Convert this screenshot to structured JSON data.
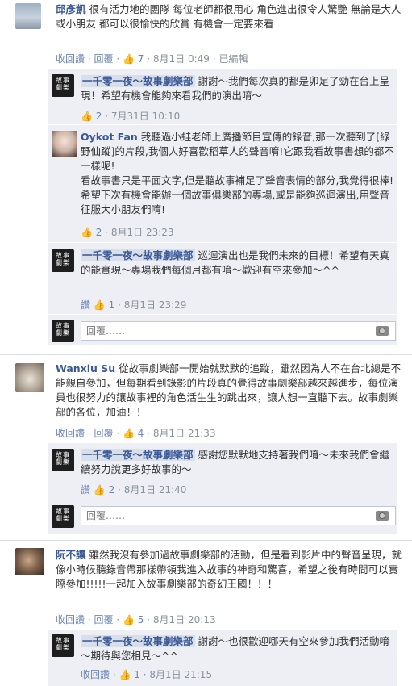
{
  "ui": {
    "reply_placeholder": "回覆……",
    "camera_icon": "camera-icon",
    "thumb_icon": "thumbs-up-icon"
  },
  "comments": [
    {
      "name": "邱彥凱",
      "text": "很有活力地的團隊 每位老師都很用心 角色進出很令人驚艷 無論是大人或小朋友 都可以很愉快的欣賞 有機會一定要來看",
      "meta": {
        "unlike": "收回讚",
        "reply": "回覆",
        "likes": "7",
        "time": "8月1日 0:49",
        "edited": "已編輯"
      },
      "replies": [
        {
          "name": "一千零一夜～故事劇樂部",
          "text": "謝謝～我們每次真的都是卯足了勁在台上呈現！希望有機會能夠來看我們的演出唷～",
          "meta": {
            "likes": "2",
            "time": "7月31日 10:10"
          }
        },
        {
          "name": "Oykot Fan",
          "text": "我聽過小蛙老師上廣播節目宣傳的錄音,那一次聽到了[綠野仙蹤]的片段,我個人好喜歡稻草人的聲音唷!它跟我看故事書想的都不一樣呢!\n看故事書只是平面文字,但是聽故事補足了聲音表情的部分,我覺得很棒!希望下次有機會能辦一個故事俱樂部的專場,或是能夠巡迴演出,用聲音征服大小朋友們唷!",
          "meta": {
            "likes": "2",
            "time": "8月1日 23:23"
          }
        },
        {
          "name": "一千零一夜～故事劇樂部",
          "text": "巡迴演出也是我們未來的目標！希望有天真的能實現～專場我們每個月都有唷～歡迎有空來參加～^^",
          "meta": {
            "like": "讚",
            "likes": "1",
            "time": "8月1日 23:29"
          }
        }
      ]
    },
    {
      "name": "Wanxiu Su",
      "text": "從故事劇樂部一開始就默默的追蹤，雖然因為人不在台北總是不能親自參加，但每期看到錄影的片段真的覺得故事劇樂部越來越進步，每位演員也很努力的讓故事裡的角色活生生的跳出來，讓人想一直聽下去。故事劇樂部的各位，加油！！",
      "meta": {
        "unlike": "收回讚",
        "reply": "回覆",
        "likes": "4",
        "time": "8月1日 21:33"
      },
      "replies": [
        {
          "name": "一千零一夜～故事劇樂部",
          "text": "感謝您默默地支持著我們唷～未來我們會繼續努力說更多好故事的～",
          "meta": {
            "like": "讚",
            "likes": "2",
            "time": "8月1日 21:40"
          }
        }
      ]
    },
    {
      "name": "阮不讓",
      "text": "雖然我沒有參加過故事劇樂部的活動，但是看到影片中的聲音呈現，就像小時候聽錄音帶那樣帶領我進入故事的神奇和驚喜，希望之後有時間可以實際參加!!!!!一起加入故事劇樂部的奇幻王國！！！",
      "meta": {
        "unlike": "收回讚",
        "reply": "回覆",
        "likes": "5",
        "time": "8月1日 20:13"
      },
      "replies": [
        {
          "name": "一千零一夜～故事劇樂部",
          "text": "謝謝～也很歡迎哪天有空來參加我們活動唷～期待與您相見～^^",
          "meta": {
            "unlike": "收回讚",
            "likes": "1",
            "time": "8月1日 21:15"
          }
        }
      ]
    }
  ]
}
